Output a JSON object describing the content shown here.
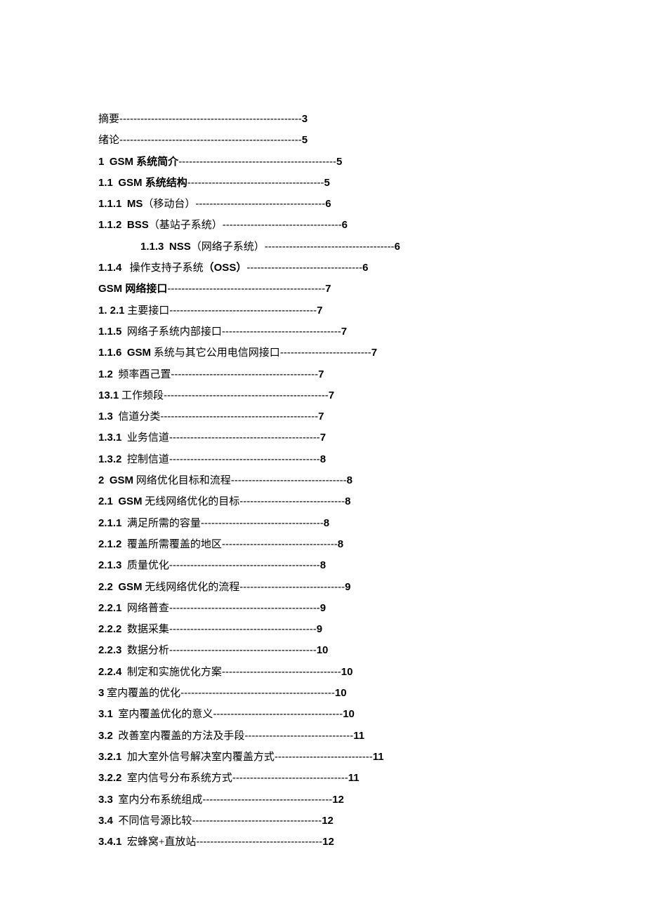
{
  "toc": [
    {
      "num": "",
      "title": "摘要",
      "dashes": "----------------------------------------------------",
      "page": "3",
      "indent": false,
      "boldTitle": false
    },
    {
      "num": "",
      "title": "绪论",
      "dashes": "----------------------------------------------------",
      "page": "5",
      "indent": false,
      "boldTitle": false
    },
    {
      "num": "1",
      "title": "GSM 系统简介",
      "dashes": "---------------------------------------------",
      "page": "5",
      "indent": false,
      "boldTitle": true
    },
    {
      "num": "1.1",
      "title": "GSM 系统结构",
      "dashes": "---------------------------------------",
      "page": "5",
      "indent": false,
      "boldTitle": true
    },
    {
      "num": "1.1.1",
      "title": "MS（移动台）",
      "dashes": "-------------------------------------",
      "page": "6",
      "indent": false,
      "boldTitle": true,
      "parenLight": true
    },
    {
      "num": "1.1.2",
      "title": "BSS（基站子系统）",
      "dashes": "----------------------------------",
      "page": "6",
      "indent": false,
      "boldTitle": true,
      "parenLight": true
    },
    {
      "num": "1.1.3",
      "title": "NSS（网络子系统）",
      "dashes": "-------------------------------------",
      "page": "6",
      "indent": true,
      "boldTitle": true,
      "parenLight": true
    },
    {
      "num": "1.1.4",
      "title": "操作支持子系统（OSS）",
      "dashes": "---------------------------------",
      "page": "6",
      "indent": false,
      "boldTitle": false,
      "ossBold": true
    },
    {
      "num": "",
      "title": "GSM 网络接口",
      "dashes": "---------------------------------------------",
      "page": "7",
      "indent": false,
      "boldTitle": true,
      "plainSuffix": " 网络接口"
    },
    {
      "num": "",
      "title": "1. 2.1 主要接口",
      "dashes": "------------------------------------------",
      "page": "7",
      "indent": false,
      "boldTitle": false,
      "prefixBold": "1. 2.1"
    },
    {
      "num": "1.1.5",
      "title": "网络子系统内部接口",
      "dashes": "----------------------------------",
      "page": "7",
      "indent": false,
      "boldTitle": false
    },
    {
      "num": "1.1.6",
      "title": "GSM 系统与其它公用电信网接口",
      "dashes": "--------------------------",
      "page": "7",
      "indent": false,
      "boldTitle": true,
      "mixedCN": true
    },
    {
      "num": "1.2",
      "title": "频率酉己置",
      "dashes": "------------------------------------------",
      "page": "7",
      "indent": false,
      "boldTitle": false
    },
    {
      "num": "13.1",
      "title": "工作频段",
      "dashes": "-----------------------------------------------",
      "page": "7",
      "indent": false,
      "boldTitle": false,
      "tightNum": true
    },
    {
      "num": "1.3",
      "title": "信道分类",
      "dashes": "---------------------------------------------",
      "page": "7",
      "indent": false,
      "boldTitle": false
    },
    {
      "num": "1.3.1",
      "title": "业务信道",
      "dashes": "-------------------------------------------",
      "page": "7",
      "indent": false,
      "boldTitle": false
    },
    {
      "num": "1.3.2",
      "title": "控制信道",
      "dashes": "-------------------------------------------",
      "page": "8",
      "indent": false,
      "boldTitle": false
    },
    {
      "num": "2",
      "title": "GSM 网络优化目标和流程",
      "dashes": "---------------------------------",
      "page": "8",
      "indent": false,
      "boldTitle": true,
      "mixedCN": true
    },
    {
      "num": "2.1",
      "title": "GSM 无线网络优化的目标",
      "dashes": "------------------------------",
      "page": "8",
      "indent": false,
      "boldTitle": true,
      "mixedCN": true
    },
    {
      "num": "2.1.1",
      "title": "满足所需的容量",
      "dashes": "-----------------------------------",
      "page": "8",
      "indent": false,
      "boldTitle": false
    },
    {
      "num": "2.1.2",
      "title": "覆盖所需覆盖的地区",
      "dashes": "---------------------------------",
      "page": "8",
      "indent": false,
      "boldTitle": false
    },
    {
      "num": "2.1.3",
      "title": "质量优化",
      "dashes": "-------------------------------------------",
      "page": "8",
      "indent": false,
      "boldTitle": false
    },
    {
      "num": "2.2",
      "title": "GSM 无线网络优化的流程",
      "dashes": "------------------------------",
      "page": "9",
      "indent": false,
      "boldTitle": true,
      "mixedCN": true
    },
    {
      "num": "2.2.1",
      "title": "网络普查",
      "dashes": "-------------------------------------------",
      "page": "9",
      "indent": false,
      "boldTitle": false
    },
    {
      "num": "2.2.2",
      "title": "数据采集",
      "dashes": "------------------------------------------",
      "page": "9",
      "indent": false,
      "boldTitle": false
    },
    {
      "num": "2.2.3",
      "title": "数据分析",
      "dashes": "------------------------------------------",
      "page": "10",
      "indent": false,
      "boldTitle": false
    },
    {
      "num": "2.2.4",
      "title": "制定和实施优化方案",
      "dashes": "----------------------------------",
      "page": "10",
      "indent": false,
      "boldTitle": false
    },
    {
      "num": "3",
      "title": "室内覆盖的优化",
      "dashes": "--------------------------------------------",
      "page": "10",
      "indent": false,
      "boldTitle": false,
      "tightNum": true
    },
    {
      "num": "3.1",
      "title": "室内覆盖优化的意义",
      "dashes": "-------------------------------------",
      "page": "10",
      "indent": false,
      "boldTitle": false
    },
    {
      "num": "3.2",
      "title": "改善室内覆盖的方法及手段",
      "dashes": "-------------------------------",
      "page": "11",
      "indent": false,
      "boldTitle": false
    },
    {
      "num": "3.2.1",
      "title": "加大室外信号解决室内覆盖方式",
      "dashes": "----------------------------",
      "page": "11",
      "indent": false,
      "boldTitle": false
    },
    {
      "num": "3.2.2",
      "title": "室内信号分布系统方式",
      "dashes": "---------------------------------",
      "page": "11",
      "indent": false,
      "boldTitle": false
    },
    {
      "num": "3.3",
      "title": "室内分布系统组成",
      "dashes": "-------------------------------------",
      "page": "12",
      "indent": false,
      "boldTitle": false
    },
    {
      "num": "3.4",
      "title": "不同信号源比较",
      "dashes": "-------------------------------------",
      "page": "12",
      "indent": false,
      "boldTitle": false
    },
    {
      "num": "3.4.1",
      "title": "宏蜂窝+直放站",
      "dashes": "------------------------------------",
      "page": "12",
      "indent": false,
      "boldTitle": false
    }
  ]
}
